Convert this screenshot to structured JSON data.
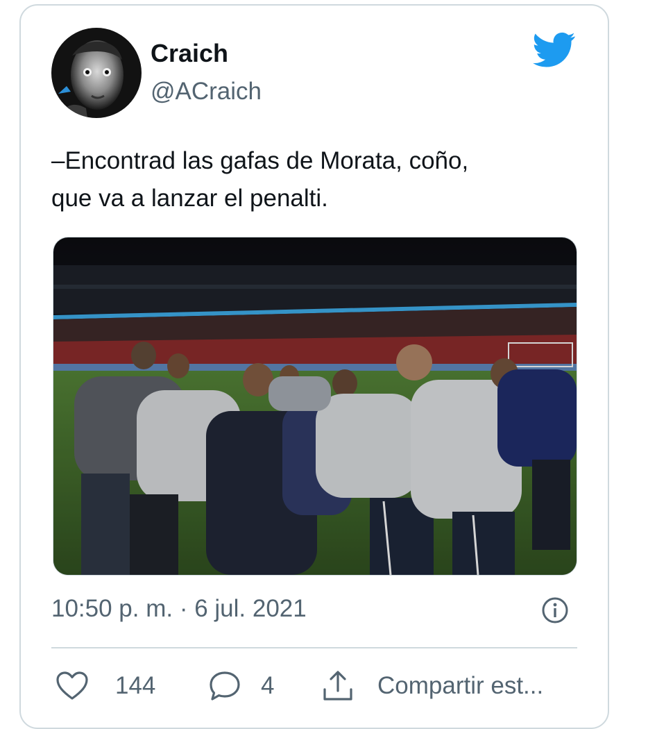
{
  "tweet": {
    "author_name": "Craich",
    "author_handle": "@ACraich",
    "text_line1": "–Encontrad las gafas de Morata, coño,",
    "text_line2": "que va a lanzar el penalti.",
    "timestamp": "10:50 p. m. · 6 jul. 2021"
  },
  "actions": {
    "like_count": "144",
    "reply_count": "4",
    "share_label": "Compartir est..."
  },
  "icons": {
    "brand": "twitter-bird-icon",
    "info": "info-icon",
    "like": "heart-icon",
    "reply": "speech-bubble-icon",
    "share": "share-icon"
  },
  "colors": {
    "brand": "#1d9bf0",
    "text": "#0f1419",
    "secondary_text": "#536471",
    "border": "#cfd9de"
  }
}
